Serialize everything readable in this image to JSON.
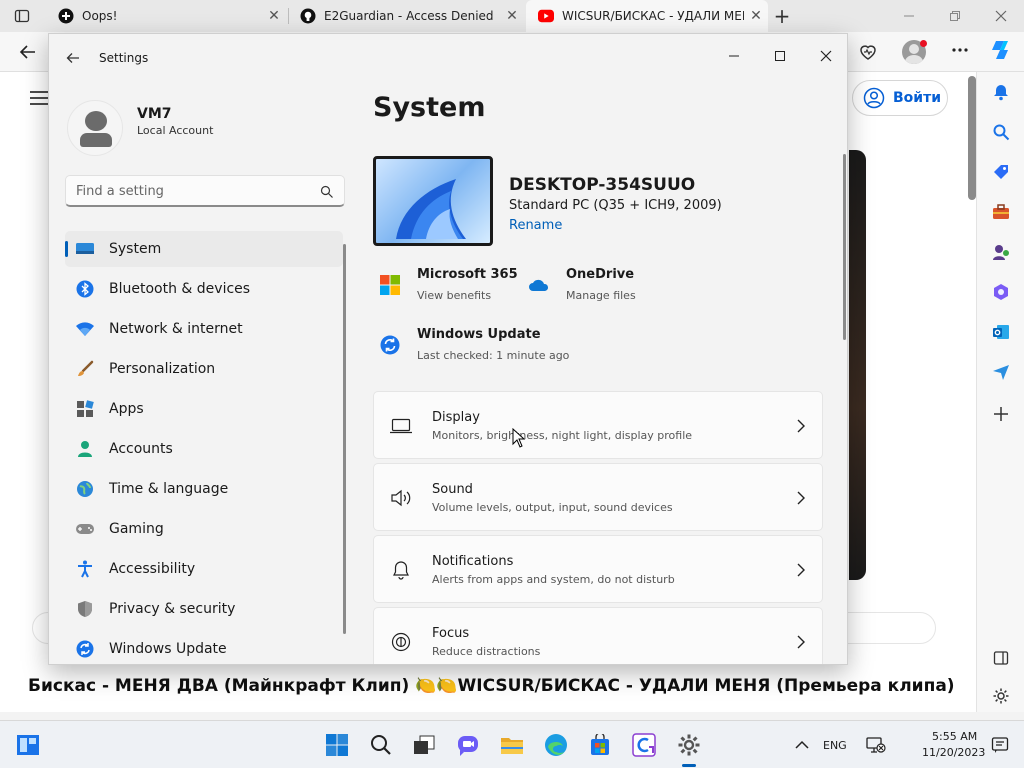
{
  "browser": {
    "tabs": [
      {
        "title": "Oops!",
        "active": false
      },
      {
        "title": "E2Guardian - Access Denied",
        "active": false
      },
      {
        "title": "WICSUR/БИСКАС - УДАЛИ МЕНЯ",
        "active": true
      }
    ],
    "new_tab": "+",
    "close_glyph": "✕",
    "page": {
      "login_label": "Войти",
      "video_title": "Бискас - МЕНЯ ДВА (Майнкрафт Клип) 🍋🍋WICSUR/БИСКАС - УДАЛИ МЕНЯ (Премьера клипа)"
    }
  },
  "settings": {
    "window_title": "Settings",
    "profile": {
      "name": "VM7",
      "account_type": "Local Account"
    },
    "search_placeholder": "Find a setting",
    "nav": [
      {
        "label": "System",
        "icon": "system-icon",
        "selected": true
      },
      {
        "label": "Bluetooth & devices",
        "icon": "bluetooth-icon"
      },
      {
        "label": "Network & internet",
        "icon": "network-icon"
      },
      {
        "label": "Personalization",
        "icon": "brush-icon"
      },
      {
        "label": "Apps",
        "icon": "apps-icon"
      },
      {
        "label": "Accounts",
        "icon": "accounts-icon"
      },
      {
        "label": "Time & language",
        "icon": "globe-icon"
      },
      {
        "label": "Gaming",
        "icon": "gamepad-icon"
      },
      {
        "label": "Accessibility",
        "icon": "accessibility-icon"
      },
      {
        "label": "Privacy & security",
        "icon": "shield-icon"
      },
      {
        "label": "Windows Update",
        "icon": "update-icon"
      }
    ],
    "content": {
      "title": "System",
      "device_name": "DESKTOP-354SUUO",
      "device_model": "Standard PC (Q35 + ICH9, 2009)",
      "rename_label": "Rename",
      "quick": [
        {
          "title": "Microsoft 365",
          "sub": "View benefits",
          "icon": "microsoft-365-icon"
        },
        {
          "title": "OneDrive",
          "sub": "Manage files",
          "icon": "onedrive-icon"
        },
        {
          "title": "Windows Update",
          "sub": "Last checked: 1 minute ago",
          "icon": "windows-update-icon"
        }
      ],
      "cards": [
        {
          "title": "Display",
          "sub": "Monitors, brightness, night light, display profile",
          "icon": "display-icon"
        },
        {
          "title": "Sound",
          "sub": "Volume levels, output, input, sound devices",
          "icon": "speaker-icon"
        },
        {
          "title": "Notifications",
          "sub": "Alerts from apps and system, do not disturb",
          "icon": "bell-icon"
        },
        {
          "title": "Focus",
          "sub": "Reduce distractions",
          "icon": "focus-icon"
        }
      ]
    }
  },
  "taskbar": {
    "language": "ENG",
    "time": "5:55 AM",
    "date": "11/20/2023"
  },
  "colors": {
    "accent": "#005fb8",
    "youtube_red": "#ff0000"
  }
}
